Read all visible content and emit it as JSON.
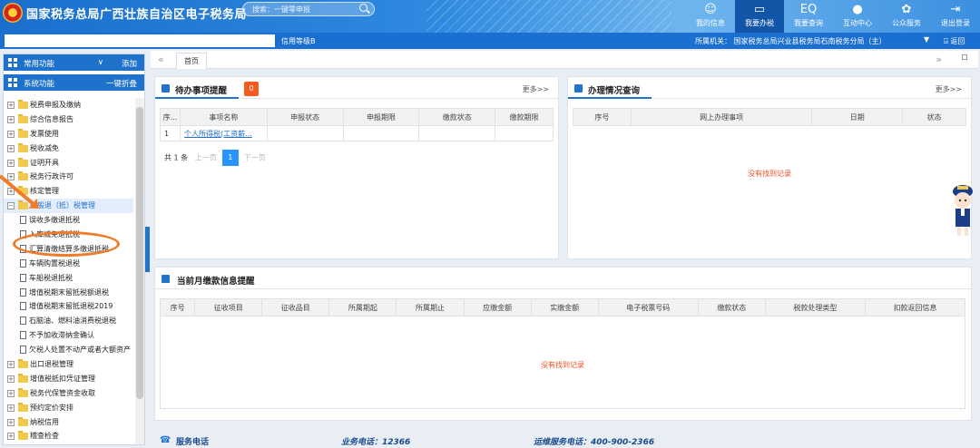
{
  "header": {
    "title": "国家税务总局广西壮族自治区电子税务局",
    "search_placeholder": "搜索：一键零申报",
    "emblem_text": "ㄧ税ㄧ",
    "nav": [
      {
        "label": "我的信息",
        "icon": "user-icon"
      },
      {
        "label": "我要办税",
        "icon": "monitor-icon"
      },
      {
        "label": "我要查询",
        "icon": "query-icon"
      },
      {
        "label": "互动中心",
        "icon": "chat-icon"
      },
      {
        "label": "公众服务",
        "icon": "service-icon"
      },
      {
        "label": "退出登录",
        "icon": "logout-icon"
      }
    ]
  },
  "bar2": {
    "credit": "信用等级B",
    "org": "所属机关：  国家税务总局兴业县税务局石南税务分局（主）",
    "ret": "返回"
  },
  "sidebar": {
    "common": "常用功能",
    "add": "添加",
    "system": "系统功能",
    "fold": "一键折叠",
    "items": [
      {
        "label": "税费申报及缴纳",
        "type": "folder"
      },
      {
        "label": "综合信息报告",
        "type": "folder"
      },
      {
        "label": "发票使用",
        "type": "folder"
      },
      {
        "label": "税收减免",
        "type": "folder"
      },
      {
        "label": "证明开具",
        "type": "folder"
      },
      {
        "label": "税务行政许可",
        "type": "folder"
      },
      {
        "label": "核定管理",
        "type": "folder"
      },
      {
        "label": "一般退（抵）税管理",
        "type": "folder",
        "open": true
      },
      {
        "label": "误收多缴退抵税",
        "type": "doc"
      },
      {
        "label": "入库减免退抵税",
        "type": "doc"
      },
      {
        "label": "汇算清缴结算多缴退抵税",
        "type": "doc"
      },
      {
        "label": "车辆购置税退税",
        "type": "doc"
      },
      {
        "label": "车船税退抵税",
        "type": "doc"
      },
      {
        "label": "增值税期末留抵税额退税",
        "type": "doc"
      },
      {
        "label": "增值税期末留抵退税2019",
        "type": "doc"
      },
      {
        "label": "石脑油、燃料油消费税退税",
        "type": "doc"
      },
      {
        "label": "不予加收滞纳金确认",
        "type": "doc"
      },
      {
        "label": "欠税人处置不动产或者大额资产",
        "type": "doc"
      },
      {
        "label": "出口退税管理",
        "type": "folder"
      },
      {
        "label": "增值税抵扣凭证管理",
        "type": "folder"
      },
      {
        "label": "税务代保管资金收取",
        "type": "folder"
      },
      {
        "label": "预约定价安排",
        "type": "folder"
      },
      {
        "label": "纳税信用",
        "type": "folder"
      },
      {
        "label": "稽查检查",
        "type": "folder"
      }
    ]
  },
  "tabs": {
    "home": "首页"
  },
  "todo": {
    "title": "待办事项提醒",
    "count": "0",
    "more": "更多>>",
    "cols": [
      "序...",
      "事项名称",
      "申报状态",
      "申报期限",
      "缴款状态",
      "缴款期限"
    ],
    "rows": [
      {
        "no": "1",
        "name": "个人所得税(工资薪...",
        "s1": "",
        "s2": "",
        "s3": "",
        "s4": ""
      }
    ],
    "pager": {
      "total": "共 1 条",
      "prev": "上一页",
      "page": "1",
      "next": "下一页"
    }
  },
  "status": {
    "title": "办理情况查询",
    "more": "更多>>",
    "cols": [
      "序号",
      "网上办理事项",
      "日期",
      "状态"
    ],
    "empty": "没有找到记录"
  },
  "payment": {
    "title": "当前月缴款信息提醒",
    "cols": [
      "序号",
      "征收项目",
      "征收品目",
      "所属期起",
      "所属期止",
      "应缴金额",
      "实缴金额",
      "电子税票号码",
      "缴款状态",
      "税款处理类型",
      "扣款返回信息"
    ],
    "empty": "没有找到记录"
  },
  "footer": {
    "service": "服务电话",
    "biz": "业务电话：12366",
    "ops": "运维服务电话：400-900-2366"
  }
}
